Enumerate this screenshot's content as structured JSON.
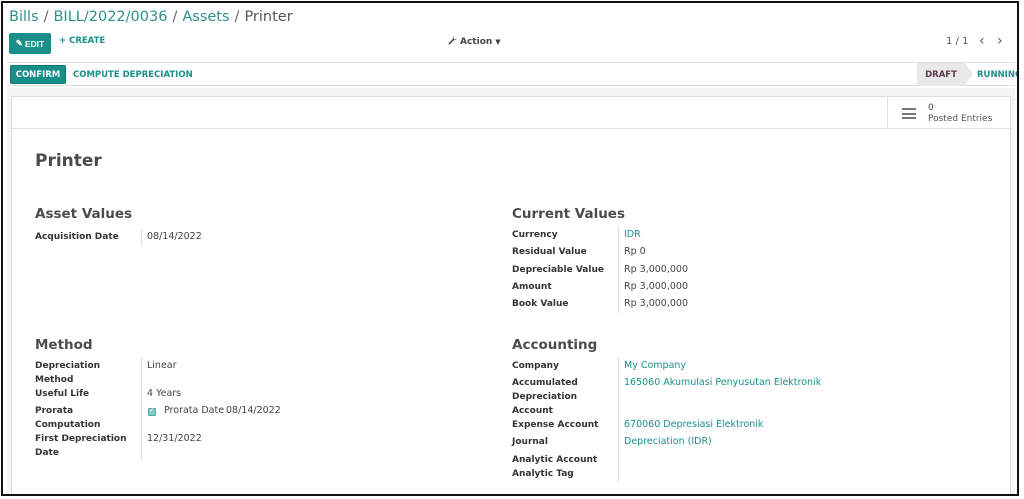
{
  "breadcrumb": {
    "bills": "Bills",
    "bill": "BILL/2022/0036",
    "assets": "Assets",
    "current": "Printer",
    "sep": "/"
  },
  "toolbar": {
    "edit_label": "EDIT",
    "create_label": "CREATE",
    "action_label": "Action"
  },
  "pager": {
    "value": "1 / 1",
    "prev": "‹",
    "next": "›"
  },
  "statusbar": {
    "confirm_label": "CONFIRM",
    "compute_label": "COMPUTE DEPRECIATION",
    "stages": [
      "DRAFT",
      "RUNNING"
    ]
  },
  "stat_button": {
    "value": "0",
    "label": "Posted Entries",
    "icon": "list-icon"
  },
  "record": {
    "title": "Printer"
  },
  "asset_values": {
    "title": "Asset Values",
    "acquisition_date_label": "Acquisition Date",
    "acquisition_date": "08/14/2022"
  },
  "current_values": {
    "title": "Current Values",
    "currency_label": "Currency",
    "currency": "IDR",
    "residual_label": "Residual Value",
    "residual": "Rp 0",
    "depreciable_label": "Depreciable Value",
    "depreciable": "Rp 3,000,000",
    "amount_label": "Amount",
    "amount": "Rp 3,000,000",
    "book_label": "Book Value",
    "book": "Rp 3,000,000"
  },
  "method": {
    "title": "Method",
    "depreciation_method_label_1": "Depreciation",
    "depreciation_method_label_2": "Method",
    "depreciation_method": "Linear",
    "useful_life_label": "Useful Life",
    "useful_life": "4 Years",
    "prorata_label_1": "Prorata",
    "prorata_label_2": "Computation",
    "prorata_date_label": "Prorata Date",
    "prorata_date": "08/14/2022",
    "first_depr_label_1": "First Depreciation",
    "first_depr_label_2": "Date",
    "first_depr_date": "12/31/2022"
  },
  "accounting": {
    "title": "Accounting",
    "company_label": "Company",
    "company": "My Company",
    "accum_label_1": "Accumulated",
    "accum_label_2": "Depreciation",
    "accum_label_3": "Account",
    "accum_account": "165060 Akumulasi Penyusutan Elektronik",
    "expense_label": "Expense Account",
    "expense_account": "670060 Depresiasi Elektronik",
    "journal_label": "Journal",
    "journal": "Depreciation (IDR)",
    "analytic_account_label": "Analytic Account",
    "analytic_tag_label": "Analytic Tag"
  },
  "colors": {
    "accent": "#1a8f8a",
    "border": "#111111"
  }
}
